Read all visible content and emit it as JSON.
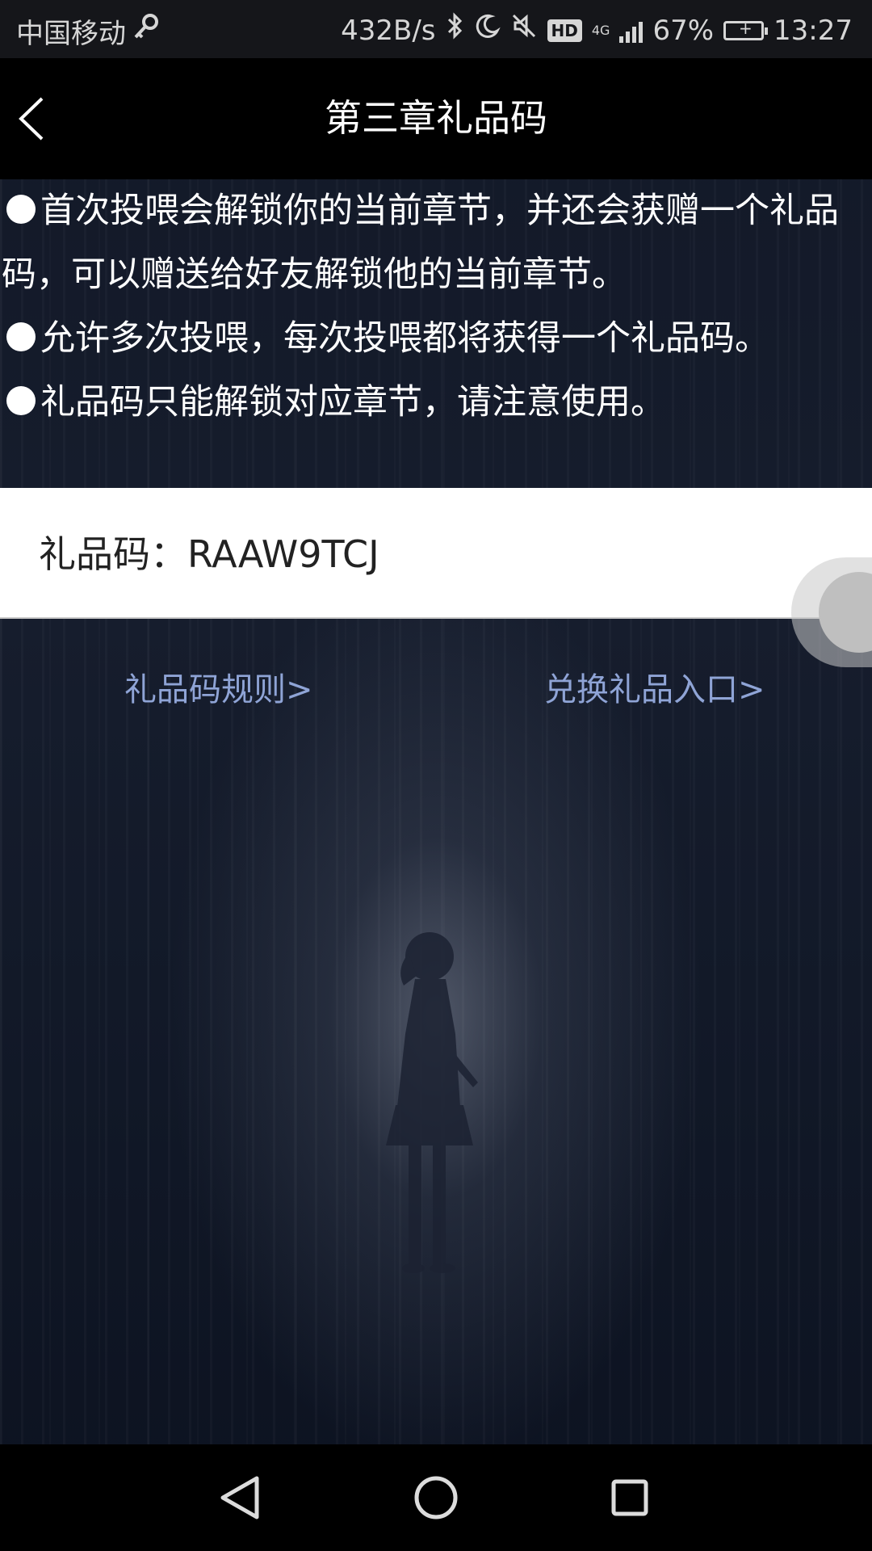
{
  "status_bar": {
    "carrier": "中国移动",
    "net_speed": "432B/s",
    "net_type": "4G",
    "battery_percent": "67%",
    "time": "13:27",
    "icons": [
      "key-icon",
      "bluetooth-icon",
      "moon-icon",
      "mute-icon",
      "hd-icon",
      "signal-icon",
      "battery-icon"
    ]
  },
  "header": {
    "title": "第三章礼品码",
    "back_icon": "chevron-left-icon"
  },
  "rules": [
    "首次投喂会解锁你的当前章节，并还会获赠一个礼品码，可以赠送给好友解锁他的当前章节。",
    "允许多次投喂，每次投喂都将获得一个礼品码。",
    "礼品码只能解锁对应章节，请注意使用。"
  ],
  "gift_code": {
    "label": "礼品码：",
    "value": "RAAW9TCJ"
  },
  "links": {
    "rules": "礼品码规则>",
    "redeem": "兑换礼品入口>"
  },
  "nav_bar": {
    "icons": [
      "nav-back-icon",
      "nav-home-icon",
      "nav-recent-icon"
    ]
  },
  "colors": {
    "link": "#8fa4d6",
    "header_bg": "#000000",
    "card_bg": "#ffffff",
    "page_bg": "#141b2b"
  }
}
